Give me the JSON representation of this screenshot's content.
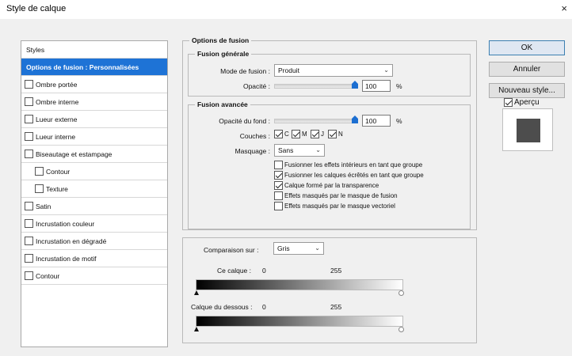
{
  "window": {
    "title": "Style de calque",
    "close_glyph": "×"
  },
  "styles_list": {
    "header": "Styles",
    "selected": "Options de fusion : Personnalisées",
    "items": [
      {
        "label": "Ombre portée",
        "checked": false,
        "indent": false
      },
      {
        "label": "Ombre interne",
        "checked": false,
        "indent": false
      },
      {
        "label": "Lueur externe",
        "checked": false,
        "indent": false
      },
      {
        "label": "Lueur interne",
        "checked": false,
        "indent": false
      },
      {
        "label": "Biseautage et estampage",
        "checked": false,
        "indent": false
      },
      {
        "label": "Contour",
        "checked": false,
        "indent": true
      },
      {
        "label": "Texture",
        "checked": false,
        "indent": true
      },
      {
        "label": "Satin",
        "checked": false,
        "indent": false
      },
      {
        "label": "Incrustation couleur",
        "checked": false,
        "indent": false
      },
      {
        "label": "Incrustation en dégradé",
        "checked": false,
        "indent": false
      },
      {
        "label": "Incrustation de motif",
        "checked": false,
        "indent": false
      },
      {
        "label": "Contour",
        "checked": false,
        "indent": false
      }
    ]
  },
  "options": {
    "title": "Options de fusion",
    "general": {
      "title": "Fusion générale",
      "mode_label": "Mode de fusion :",
      "mode_value": "Produit",
      "opacity_label": "Opacité :",
      "opacity_value": "100",
      "opacity_level": 1.0,
      "unit": "%"
    },
    "advanced": {
      "title": "Fusion avancée",
      "fill_opacity_label": "Opacité du fond :",
      "fill_opacity_value": "100",
      "fill_opacity_level": 1.0,
      "unit": "%",
      "channels_label": "Couches :",
      "channels": [
        {
          "label": "C",
          "checked": true
        },
        {
          "label": "M",
          "checked": true
        },
        {
          "label": "J",
          "checked": true
        },
        {
          "label": "N",
          "checked": true
        }
      ],
      "knockout_label": "Masquage :",
      "knockout_value": "Sans",
      "options": [
        {
          "label": "Fusionner les effets intérieurs en tant que groupe",
          "checked": false
        },
        {
          "label": "Fusionner les calques écrêtés en tant que groupe",
          "checked": true
        },
        {
          "label": "Calque formé par la transparence",
          "checked": true
        },
        {
          "label": "Effets masqués par le masque de fusion",
          "checked": false
        },
        {
          "label": "Effets masqués par le masque vectoriel",
          "checked": false
        }
      ]
    },
    "blend_if": {
      "label": "Comparaison sur :",
      "value": "Gris",
      "this_layer_label": "Ce calque :",
      "this_layer_min": "0",
      "this_layer_max": "255",
      "underlying_label": "Calque du dessous :",
      "underlying_min": "0",
      "underlying_max": "255"
    }
  },
  "buttons": {
    "ok": "OK",
    "cancel": "Annuler",
    "new_style": "Nouveau style...",
    "preview_label": "Aperçu",
    "preview_checked": true,
    "preview_color": "#4d4d4d"
  },
  "colors": {
    "accent": "#1e73d6"
  }
}
